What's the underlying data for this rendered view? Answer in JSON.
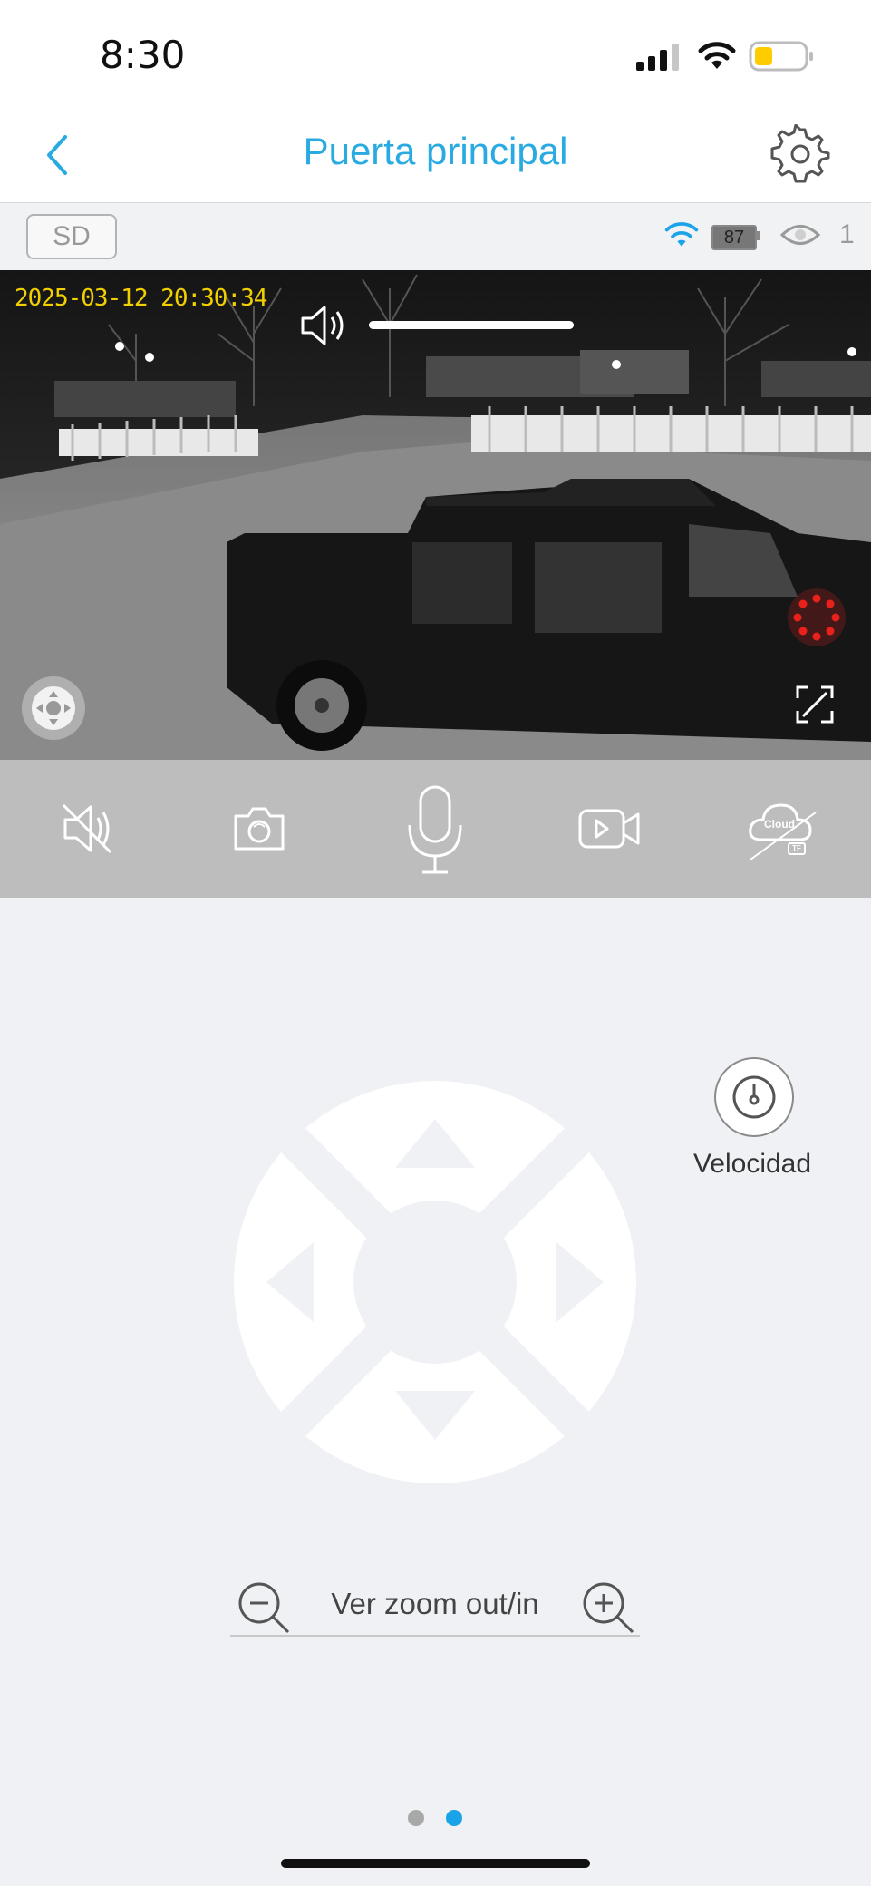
{
  "status_bar": {
    "time": "8:30",
    "battery_color": "#ffcc00"
  },
  "header": {
    "title": "Puerta principal",
    "accent_color": "#29abe2"
  },
  "info_bar": {
    "storage_badge": "SD",
    "battery_level": "87",
    "viewer_count": "1"
  },
  "video": {
    "timestamp": "2025-03-12  20:30:34",
    "timestamp_color": "#f2d000",
    "volume_level": 1.0
  },
  "controls": [
    {
      "name": "mute-button",
      "icon": "speaker-muted-icon"
    },
    {
      "name": "snapshot-button",
      "icon": "camera-icon"
    },
    {
      "name": "talk-button",
      "icon": "microphone-icon"
    },
    {
      "name": "record-button",
      "icon": "video-camera-icon"
    },
    {
      "name": "cloud-button",
      "icon": "cloud-off-icon",
      "label": "Cloud",
      "sub_label": "TF"
    }
  ],
  "ptz": {
    "velocity_label": "Velocidad"
  },
  "zoom": {
    "label": "Ver zoom out/in"
  },
  "pager": {
    "total": 2,
    "active_index": 1,
    "active_color": "#1aa3e8",
    "inactive_color": "#a8a8a8"
  }
}
